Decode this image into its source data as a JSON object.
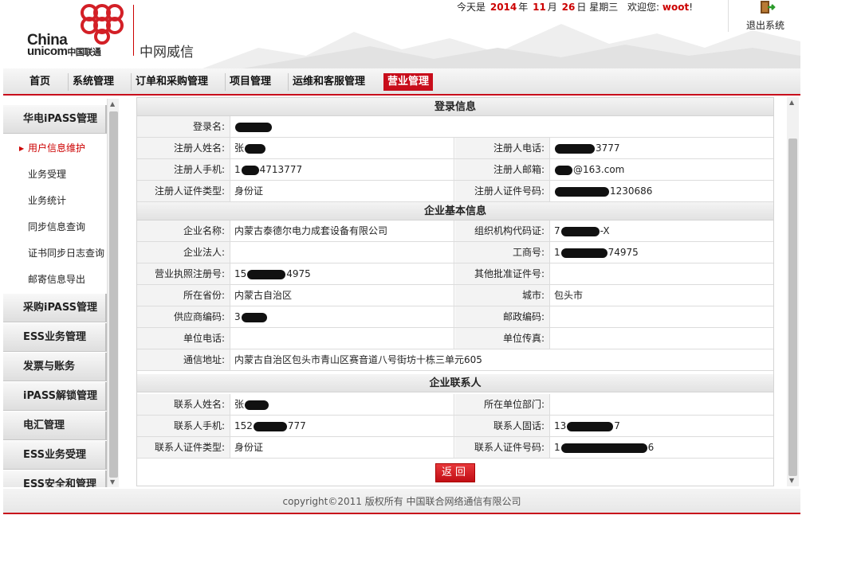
{
  "header": {
    "logo_china": "China",
    "logo_unicom": "unicom",
    "logo_cn": "中国联通",
    "system_name": "中网威信",
    "date_prefix": "今天是",
    "year": "2014",
    "year_unit": "年",
    "month": "11",
    "month_unit": "月",
    "day": "26",
    "day_unit": "日",
    "weekday": "星期三",
    "welcome": "欢迎您:",
    "username": "woot",
    "welcome_suffix": "!",
    "logout_label": "退出系统"
  },
  "nav": {
    "items": [
      "首页",
      "系统管理",
      "订单和采购管理",
      "项目管理",
      "运维和客服管理",
      "营业管理"
    ],
    "active_index": 5
  },
  "sidebar": {
    "groups_top": [
      "华电iPASS管理"
    ],
    "items": [
      "用户信息维护",
      "业务受理",
      "业务统计",
      "同步信息查询",
      "证书同步日志查询",
      "邮寄信息导出"
    ],
    "active_item": 0,
    "groups_bottom": [
      "采购iPASS管理",
      "ESS业务管理",
      "发票与账务",
      "iPASS解锁管理",
      "电汇管理",
      "ESS业务受理",
      "ESS安全和管理"
    ]
  },
  "login_section": {
    "title": "登录信息",
    "login_name_label": "登录名:",
    "reg_name_label": "注册人姓名:",
    "reg_name_value": "张",
    "reg_phone_label": "注册人电话:",
    "reg_phone_value": "3777",
    "reg_mobile_label": "注册人手机:",
    "reg_mobile_prefix": "1",
    "reg_mobile_value": "4713777",
    "reg_email_label": "注册人邮箱:",
    "reg_email_value": "@163.com",
    "reg_id_type_label": "注册人证件类型:",
    "reg_id_type_value": "身份证",
    "reg_id_no_label": "注册人证件号码:",
    "reg_id_no_value": "1230686"
  },
  "company_section": {
    "title": "企业基本信息",
    "name_label": "企业名称:",
    "name_value": "内蒙古泰德尔电力成套设备有限公司",
    "org_code_label": "组织机构代码证:",
    "org_code_prefix": "7",
    "org_code_value": "-X",
    "legal_label": "企业法人:",
    "legal_value": "",
    "biz_no_label": "工商号:",
    "biz_no_prefix": "1",
    "biz_no_value": "74975",
    "license_label": "营业执照注册号:",
    "license_prefix": "15",
    "license_value": "4975",
    "other_cert_label": "其他批准证件号:",
    "other_cert_value": "",
    "province_label": "所在省份:",
    "province_value": "内蒙古自治区",
    "city_label": "城市:",
    "city_value": "包头市",
    "supplier_label": "供应商编码:",
    "supplier_prefix": "3",
    "postal_label": "邮政编码:",
    "postal_value": "",
    "phone_label": "单位电话:",
    "phone_value": "",
    "fax_label": "单位传真:",
    "fax_value": "",
    "address_label": "通信地址:",
    "address_value": "内蒙古自治区包头市青山区赛音道八号街坊十栋三单元605"
  },
  "contact_section": {
    "title": "企业联系人",
    "name_label": "联系人姓名:",
    "name_value": "张",
    "dept_label": "所在单位部门:",
    "dept_value": "",
    "mobile_label": "联系人手机:",
    "mobile_prefix": "152",
    "mobile_value": "777",
    "tel_label": "联系人固话:",
    "tel_prefix": "13",
    "tel_value": "7",
    "id_type_label": "联系人证件类型:",
    "id_type_value": "身份证",
    "id_no_label": "联系人证件号码:",
    "id_no_prefix": "1",
    "id_no_value": "6"
  },
  "back_button": "返回",
  "footer": "copyright©2011 版权所有 中国联合网络通信有限公司",
  "colors": {
    "brand_red": "#c80d1b",
    "date_red": "#cc0000"
  }
}
